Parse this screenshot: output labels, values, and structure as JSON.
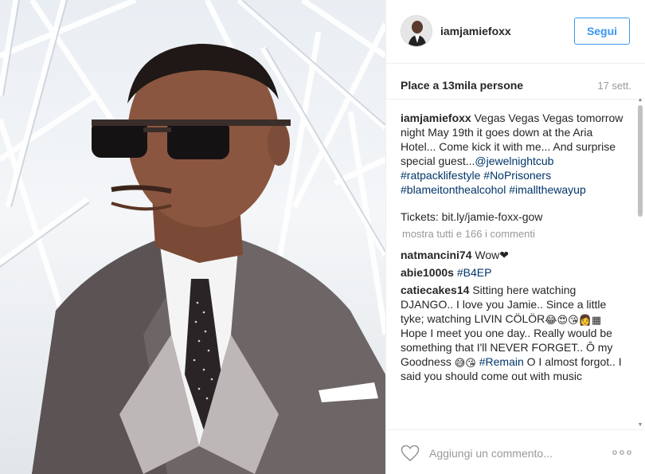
{
  "post": {
    "username": "iamjamiefoxx",
    "follow_label": "Segui",
    "likes_text": "Place a 13mila persone",
    "timestamp": "17 sett."
  },
  "caption": {
    "username": "iamjamiefoxx",
    "text": "Vegas Vegas Vegas tomorrow night May 19th it goes down at the Aria Hotel... Come kick it with me... And surprise special guest...",
    "mention": "@jewelnightcub",
    "tags": [
      "#ratpacklifestyle",
      "#NoPrisoners",
      "#blameitonthealcohol",
      "#imalltheway"
    ],
    "tag_tail": "up",
    "tickets": "Tickets: bit.ly/jamie-foxx-gow"
  },
  "show_all": "mostra tutti e 166 i commenti",
  "comments": [
    {
      "username": "natmancini74",
      "text": "Wow❤"
    },
    {
      "username": "abie1000s",
      "tag": "#B4EP"
    },
    {
      "username": "catiecakes14",
      "text_1": "Sitting here watching DJANGO.. I love you Jamie.. Since a little tyke; watching LIVIN CÖLÖR",
      "text_2": "Hope I meet you one day.. Really would be something that I'll NEVER FORGET.. Ô my Goodness",
      "tag": "#Remain",
      "text_3": "O I almost forgot.. I said you should come out with music"
    }
  ],
  "footer": {
    "comment_placeholder": "Aggiungi un commento...",
    "icons": [
      "heart-icon",
      "more-options-icon"
    ]
  },
  "colors": {
    "link": "#003569",
    "follow": "#3897f0",
    "muted": "#999999"
  }
}
